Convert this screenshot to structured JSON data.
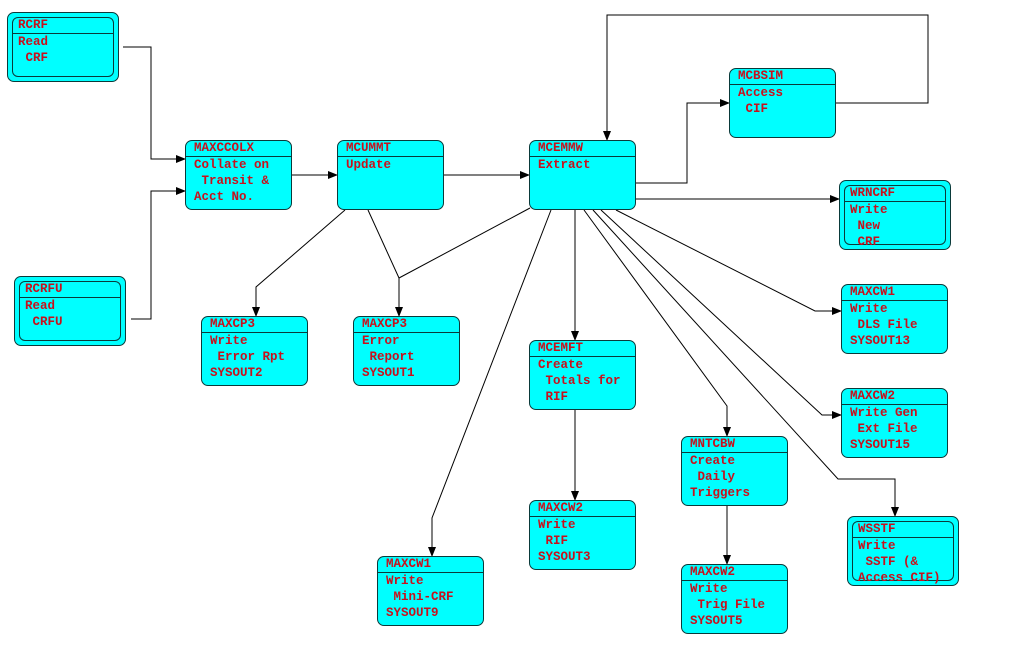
{
  "colors": {
    "box_fill": "#00ffff",
    "text": "#c8101c",
    "line": "#000000"
  },
  "nodes": [
    {
      "id": "rcrf",
      "name": "RCRF",
      "lines": [
        "Read",
        " CRF"
      ],
      "kind": "file"
    },
    {
      "id": "maxccolx",
      "name": "MAXCCOLX",
      "lines": [
        "Collate on",
        " Transit &",
        "Acct No."
      ],
      "kind": "process"
    },
    {
      "id": "mcummt",
      "name": "MCUMMT",
      "lines": [
        "Update"
      ],
      "kind": "process"
    },
    {
      "id": "mcemmw",
      "name": "MCEMMW",
      "lines": [
        "Extract"
      ],
      "kind": "process"
    },
    {
      "id": "mcbsim",
      "name": "MCBSIM",
      "lines": [
        "Access",
        " CIF"
      ],
      "kind": "process"
    },
    {
      "id": "wrncrf",
      "name": "WRNCRF",
      "lines": [
        "Write",
        " New",
        " CRF"
      ],
      "kind": "file"
    },
    {
      "id": "rcrfu",
      "name": "RCRFU",
      "lines": [
        "Read",
        " CRFU"
      ],
      "kind": "file"
    },
    {
      "id": "maxcp3a",
      "name": "MAXCP3",
      "lines": [
        "Write",
        " Error Rpt",
        "SYSOUT2"
      ],
      "kind": "process"
    },
    {
      "id": "maxcp3b",
      "name": "MAXCP3",
      "lines": [
        "Error",
        " Report",
        "SYSOUT1"
      ],
      "kind": "process"
    },
    {
      "id": "mcemft",
      "name": "MCEMFT",
      "lines": [
        "Create",
        " Totals for",
        " RIF"
      ],
      "kind": "process"
    },
    {
      "id": "maxcw1dls",
      "name": "MAXCW1",
      "lines": [
        "Write",
        " DLS File",
        "SYSOUT13"
      ],
      "kind": "process"
    },
    {
      "id": "maxcw2gen",
      "name": "MAXCW2",
      "lines": [
        "Write Gen",
        " Ext File",
        "SYSOUT15"
      ],
      "kind": "process"
    },
    {
      "id": "mntcbw",
      "name": "MNTCBW",
      "lines": [
        "Create",
        " Daily",
        "Triggers"
      ],
      "kind": "process"
    },
    {
      "id": "maxcw2rif",
      "name": "MAXCW2",
      "lines": [
        "Write",
        " RIF",
        "SYSOUT3"
      ],
      "kind": "process"
    },
    {
      "id": "maxcw1mini",
      "name": "MAXCW1",
      "lines": [
        "Write",
        " Mini-CRF",
        "SYSOUT9"
      ],
      "kind": "process"
    },
    {
      "id": "maxcw2trig",
      "name": "MAXCW2",
      "lines": [
        "Write",
        " Trig File",
        "SYSOUT5"
      ],
      "kind": "process"
    },
    {
      "id": "wsstf",
      "name": "WSSTF",
      "lines": [
        "Write",
        " SSTF (&",
        "Access CIF)"
      ],
      "kind": "file"
    }
  ],
  "edges": [
    [
      "rcrf",
      "maxccolx"
    ],
    [
      "rcrfu",
      "maxccolx"
    ],
    [
      "maxccolx",
      "mcummt"
    ],
    [
      "mcummt",
      "mcemmw"
    ],
    [
      "mcemmw",
      "mcbsim"
    ],
    [
      "mcbsim",
      "mcemmw"
    ],
    [
      "mcemmw",
      "wrncrf"
    ],
    [
      "mcummt",
      "maxcp3a"
    ],
    [
      "mcummt",
      "maxcp3b"
    ],
    [
      "mcemmw",
      "maxcp3b"
    ],
    [
      "mcemmw",
      "maxcw1mini"
    ],
    [
      "mcemmw",
      "mcemft"
    ],
    [
      "mcemft",
      "maxcw2rif"
    ],
    [
      "mcemmw",
      "mntcbw"
    ],
    [
      "mntcbw",
      "maxcw2trig"
    ],
    [
      "mcemmw",
      "wsstf"
    ],
    [
      "mcemmw",
      "maxcw2gen"
    ],
    [
      "mcemmw",
      "maxcw1dls"
    ]
  ]
}
